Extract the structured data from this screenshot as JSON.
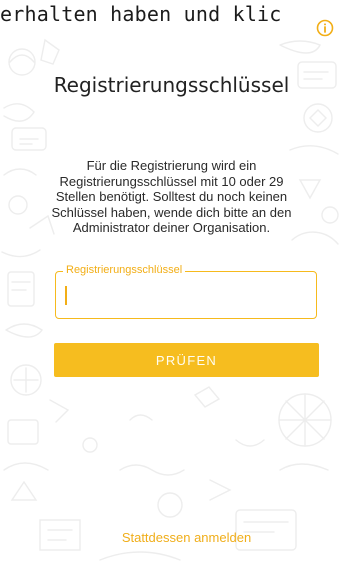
{
  "banner": {
    "text": "erhalten haben und klic"
  },
  "info": {
    "icon": "info-icon"
  },
  "registration": {
    "title": "Registrierungsschlüssel",
    "description": "Für die Registrierung wird ein Registrierungsschlüssel mit 10 oder 29 Stellen benötigt. Solltest du noch keinen Schlüssel haben, wende dich bitte an den Administrator deiner Organisation.",
    "field_label": "Registrierungsschlüssel",
    "field_value": "",
    "submit_label": "PRÜFEN",
    "alt_login_label": "Stattdessen anmelden"
  },
  "colors": {
    "accent": "#F6BD1F",
    "accent_text": "#F2AE16",
    "doodle": "#EEEEEE"
  }
}
